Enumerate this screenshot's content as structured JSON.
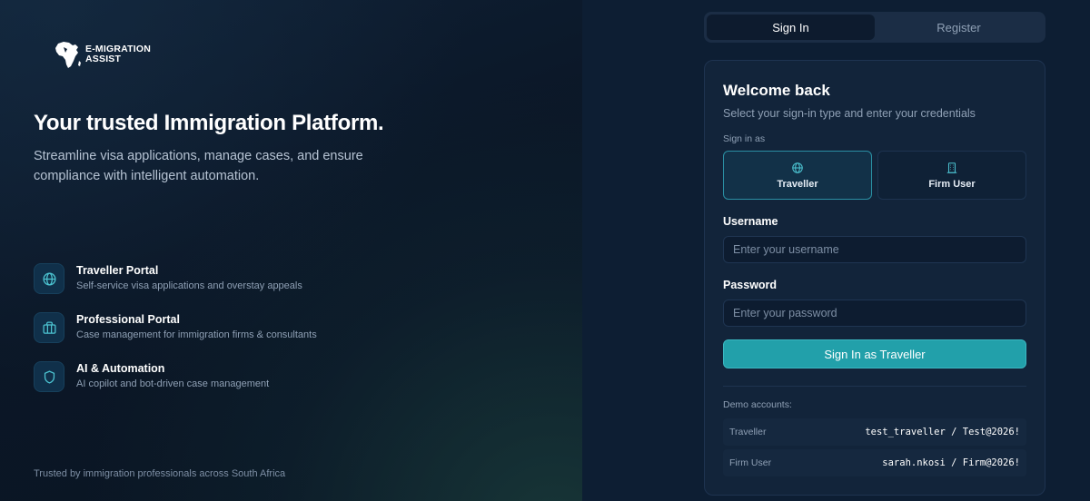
{
  "brand": {
    "logo_text": "E-MIGRATION ASSIST",
    "logo_icon": "africa-map-icon"
  },
  "hero": {
    "headline": "Your trusted Immigration Platform.",
    "subline": "Streamline visa applications, manage cases, and ensure compliance with intelligent automation."
  },
  "features": [
    {
      "icon": "globe-icon",
      "title": "Traveller Portal",
      "desc": "Self-service visa applications and overstay appeals"
    },
    {
      "icon": "briefcase-icon",
      "title": "Professional Portal",
      "desc": "Case management for immigration firms & consultants"
    },
    {
      "icon": "shield-icon",
      "title": "AI & Automation",
      "desc": "AI copilot and bot-driven case management"
    }
  ],
  "footer": {
    "trusted": "Trusted by immigration professionals across South Africa"
  },
  "tabs": {
    "signin": "Sign In",
    "register": "Register",
    "active": "signin"
  },
  "card": {
    "title": "Welcome back",
    "subtitle": "Select your sign-in type and enter your credentials",
    "signin_as_label": "Sign in as",
    "types": [
      {
        "icon": "globe-icon",
        "label": "Traveller",
        "selected": true
      },
      {
        "icon": "building-icon",
        "label": "Firm User",
        "selected": false
      }
    ],
    "username": {
      "label": "Username",
      "placeholder": "Enter your username",
      "value": ""
    },
    "password": {
      "label": "Password",
      "placeholder": "Enter your password",
      "value": ""
    },
    "submit_label": "Sign In as Traveller",
    "demo": {
      "label": "Demo accounts:",
      "accounts": [
        {
          "role": "Traveller",
          "credentials": "test_traveller / Test@2026!"
        },
        {
          "role": "Firm User",
          "credentials": "sarah.nkosi / Firm@2026!"
        }
      ]
    }
  },
  "colors": {
    "accent": "#22a0aa",
    "background": "#0b1a2c",
    "card": "#12243a"
  }
}
